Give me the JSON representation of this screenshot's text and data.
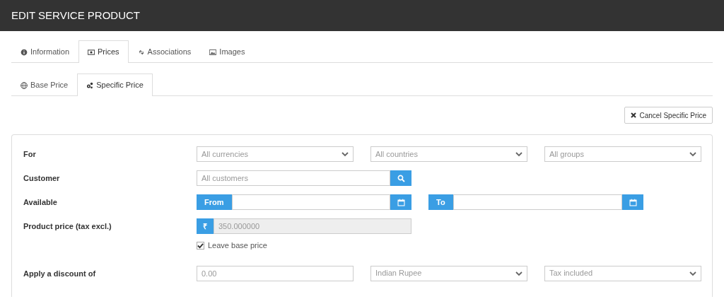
{
  "header": {
    "title": "EDIT SERVICE PRODUCT"
  },
  "tabs": [
    {
      "label": "Information",
      "kind": "info",
      "selected": false
    },
    {
      "label": "Prices",
      "kind": "money",
      "selected": true
    },
    {
      "label": "Associations",
      "kind": "link",
      "selected": false
    },
    {
      "label": "Images",
      "kind": "image",
      "selected": false
    }
  ],
  "subtabs": [
    {
      "label": "Base Price",
      "kind": "globe",
      "selected": false
    },
    {
      "label": "Specific Price",
      "kind": "cogs",
      "selected": true
    }
  ],
  "cancel_button": {
    "label": "Cancel Specific Price"
  },
  "form": {
    "for": {
      "label": "For",
      "selects": [
        "All currencies",
        "All countries",
        "All groups"
      ]
    },
    "customer": {
      "label": "Customer",
      "placeholder": "All customers"
    },
    "available": {
      "label": "Available",
      "from": "From",
      "to": "To"
    },
    "product_price": {
      "label": "Product price (tax excl.)",
      "currency": "₹",
      "value": "350.000000",
      "leave_base_price": {
        "label": "Leave base price",
        "checked": true
      }
    },
    "discount": {
      "label": "Apply a discount of",
      "placeholder": "0.00",
      "selects": [
        "Indian Rupee",
        "Tax included"
      ]
    }
  }
}
